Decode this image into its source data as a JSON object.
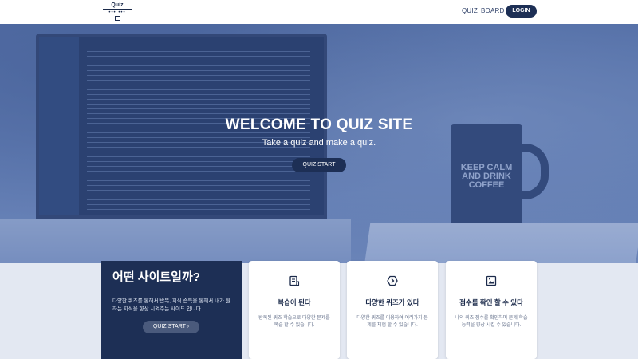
{
  "header": {
    "logo_text": "Quiz",
    "logo_dots": "••• •••",
    "nav": [
      {
        "label": "QUIZ"
      },
      {
        "label": "BOARD"
      }
    ],
    "login_label": "LOGIN"
  },
  "hero": {
    "title": "WELCOME TO QUIZ SITE",
    "subtitle": "Take a quiz and make a quiz.",
    "button_label": "QUIZ START",
    "mug_text": "KEEP CALM AND DRINK COFFEE"
  },
  "intro_card": {
    "title": "어떤 사이트일까?",
    "description": "다양한 퀴즈를 통해서 반복, 지식 습득을 통해서 내가 원하는 지식을 향상 시켜주는 사이드 입니다.",
    "button_label": "QUIZ START  ›"
  },
  "feature_cards": [
    {
      "icon": "document-icon",
      "title": "복습이 된다",
      "description": "반복된 퀴즈 학습으로 다양한 문제를 복습 할 수 있습니다."
    },
    {
      "icon": "hexagon-arrow-icon",
      "title": "다양한 퀴즈가 있다",
      "description": "다양한 퀴즈를 이용하여 여러가지 문제를 체험 할 수 있습니다."
    },
    {
      "icon": "image-frame-icon",
      "title": "점수를 확인 할 수 있다",
      "description": "나의 퀴즈 점수를 확인하며 문제 학습 능력을 향상 시킬 수 있습니다."
    }
  ],
  "colors": {
    "primary": "#1d2f55",
    "hero_tint": "#6c85b6",
    "background": "#e3e8f2"
  }
}
